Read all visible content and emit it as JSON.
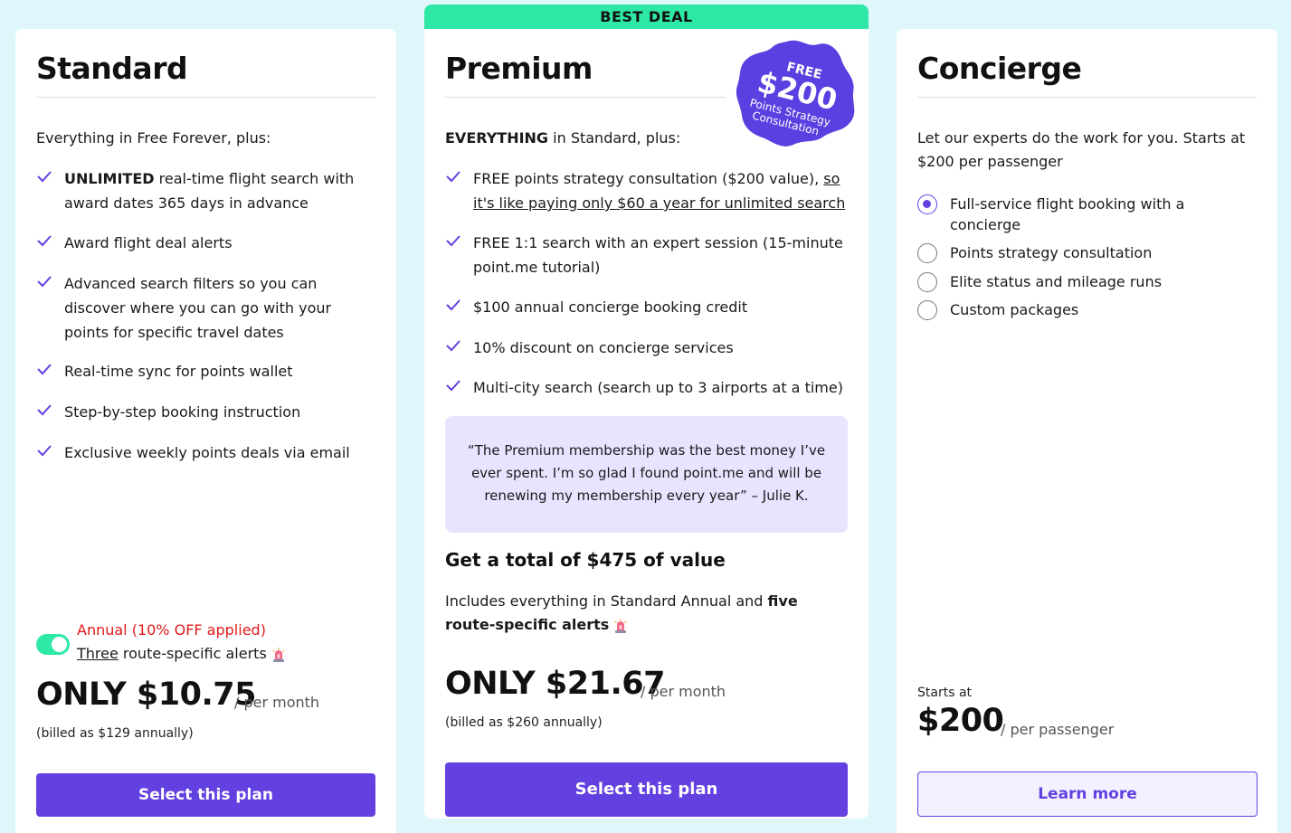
{
  "standard": {
    "title": "Standard",
    "intro": "Everything in Free Forever, plus:",
    "features": [
      {
        "bold": "UNLIMITED",
        "text": " real-time flight search with award dates 365 days in advance"
      },
      {
        "text": "Award flight deal alerts"
      },
      {
        "text": "Advanced search filters so you can discover where you can go with your points for specific travel dates"
      },
      {
        "text": "Real-time sync for points wallet"
      },
      {
        "text": "Step-by-step booking instruction"
      },
      {
        "text": "Exclusive weekly points deals via email"
      }
    ],
    "toggle_label": "Annual (10% OFF applied)",
    "route_count": "Three",
    "route_text": " route-specific alerts",
    "price": "ONLY $10.75",
    "per": "/ per month",
    "billed": "(billed as $129 annually)",
    "button": "Select this plan"
  },
  "premium": {
    "banner": "BEST DEAL",
    "title": "Premium",
    "badge": {
      "line1": "FREE",
      "line2": "$200",
      "line3": "Points Strategy",
      "line4": "Consultation"
    },
    "intro_bold": "EVERYTHING",
    "intro_rest": " in Standard, plus:",
    "features": [
      {
        "text": "FREE points strategy consultation ($200 value), ",
        "link": "so it's like paying only $60 a year for unlimited search"
      },
      {
        "text": "FREE 1:1 search with an expert session (15-minute point.me tutorial)"
      },
      {
        "text": "$100 annual concierge booking credit"
      },
      {
        "text": "10% discount on concierge services"
      },
      {
        "text": "Multi-city search (search up to 3 airports at a time)"
      }
    ],
    "testimonial": "“The Premium membership was the best money I’ve ever spent. I’m so glad I found point.me and will be renewing my membership every year” – Julie K.",
    "total_value": "Get a total of $475 of value",
    "includes_text": "Includes everything in Standard Annual and ",
    "includes_bold": "five route-specific alerts",
    "price": "ONLY $21.67",
    "per": "/ per month",
    "billed": "(billed as $260 annually)",
    "button": "Select this plan"
  },
  "concierge": {
    "title": "Concierge",
    "intro": "Let our experts do the work for you. Starts at $200 per passenger",
    "options": [
      {
        "label": "Full-service flight booking with a concierge",
        "checked": true
      },
      {
        "label": "Points strategy consultation",
        "checked": false
      },
      {
        "label": "Elite status and mileage runs",
        "checked": false
      },
      {
        "label": "Custom packages",
        "checked": false
      }
    ],
    "starts_at": "Starts at",
    "price": "$200",
    "per": "/ per passenger",
    "button": "Learn more"
  },
  "colors": {
    "accent": "#6340e0",
    "banner": "#2ee8a6",
    "alert": "#e01b1b",
    "testimonial_bg": "#e8e4ff"
  },
  "icons": {
    "check": "check-icon",
    "siren": "siren-icon"
  }
}
